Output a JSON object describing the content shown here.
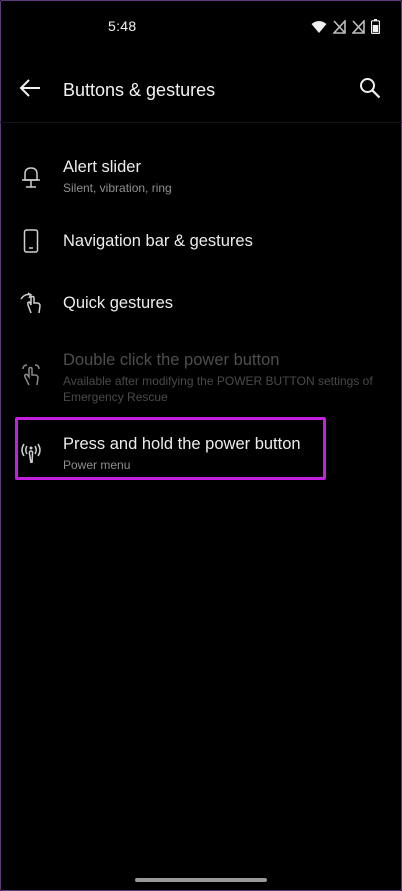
{
  "status_bar": {
    "time": "5:48",
    "icons": [
      "wifi-icon",
      "no-signal-icon",
      "no-signal-icon",
      "battery-icon"
    ]
  },
  "app_bar": {
    "title": "Buttons & gestures",
    "back_icon": "arrow-left-icon",
    "search_icon": "search-icon"
  },
  "settings": {
    "items": [
      {
        "title": "Alert slider",
        "subtitle": "Silent, vibration, ring",
        "icon": "bell-slider-icon",
        "enabled": true
      },
      {
        "title": "Navigation bar & gestures",
        "subtitle": "",
        "icon": "phone-icon",
        "enabled": true
      },
      {
        "title": "Quick gestures",
        "subtitle": "",
        "icon": "gesture-hand-icon",
        "enabled": true
      },
      {
        "title": "Double click the power button",
        "subtitle": "Available after modifying the POWER BUTTON settings of Emergency Rescue",
        "icon": "double-tap-icon",
        "enabled": false
      },
      {
        "title": "Press and hold the power button",
        "subtitle": "Power menu",
        "icon": "press-hold-icon",
        "enabled": true
      }
    ]
  },
  "colors": {
    "background": "#000000",
    "highlight": "#c21fde",
    "text_primary": "#ececec",
    "text_secondary": "#8e8e8e",
    "text_disabled": "#4e4e4e"
  }
}
